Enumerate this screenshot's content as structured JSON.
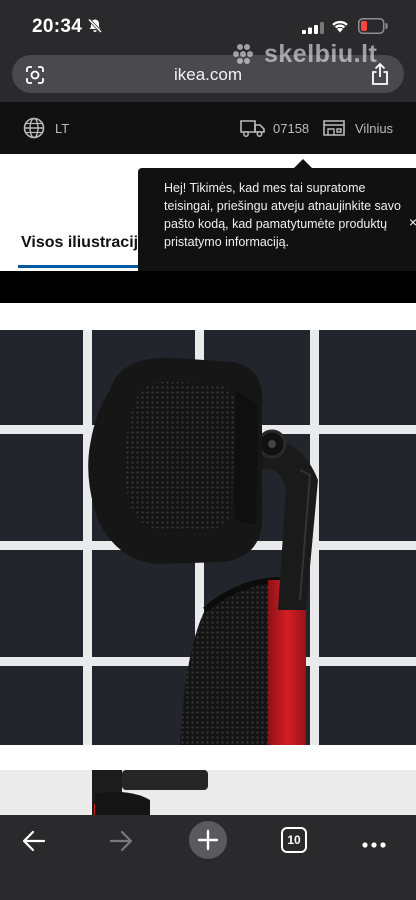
{
  "status_bar": {
    "time": "20:34",
    "icons": [
      "bell-slash-icon",
      "signal-icon",
      "wifi-icon",
      "battery-low-icon"
    ],
    "battery_color": "#ff453a"
  },
  "browser": {
    "url": "ikea.com",
    "watermark": "skelbiu.lt",
    "icons": [
      "google-lens-icon",
      "share-icon"
    ]
  },
  "ikea_bar": {
    "language": "LT",
    "postal_code": "07158",
    "store": "Vilnius",
    "icons": [
      "globe-icon",
      "truck-icon",
      "store-icon"
    ]
  },
  "tab": {
    "label": "Visos iliustracijo",
    "underline_color": "#0058a3"
  },
  "tooltip": {
    "message": "Hej! Tikimės, kad mes tai supratome teisingai, priešingu atveju atnaujinkite savo pašto kodą, kad pamatytumėte produktų pristatymo informaciją.",
    "close": "×"
  },
  "product_image": {
    "subject": "headrest-and-backrest-of-office-chair",
    "accent_color": "#d21f25"
  },
  "toolbar": {
    "tab_count": "10",
    "icons": [
      "back-arrow-icon",
      "forward-arrow-icon",
      "new-tab-plus-icon",
      "tabs-icon",
      "more-icon"
    ]
  }
}
